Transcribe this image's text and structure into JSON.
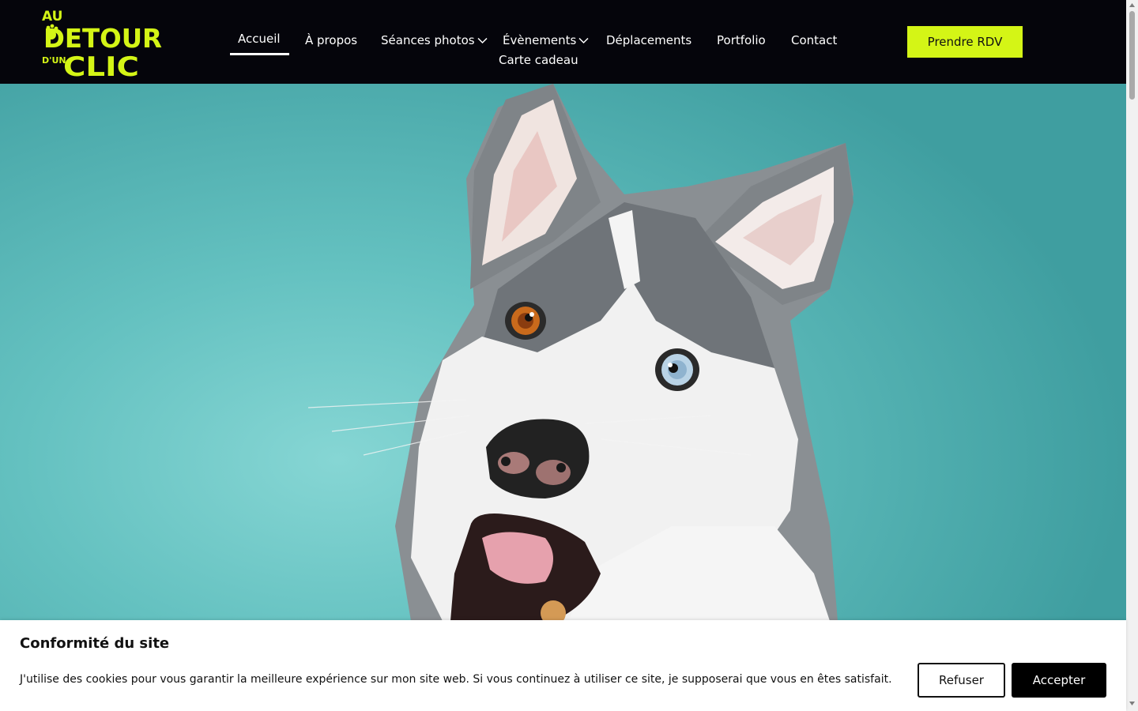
{
  "brand": {
    "logo_line1": "AU",
    "logo_line2": "DETOUR",
    "logo_line3a": "D'UN",
    "logo_line3b": "CLIC",
    "accent_color": "#d4f516"
  },
  "nav": {
    "items": [
      {
        "label": "Accueil",
        "active": true
      },
      {
        "label": "À propos"
      },
      {
        "label": "Séances photos",
        "has_submenu": true
      },
      {
        "label": "Évènements",
        "has_submenu": true
      },
      {
        "label": "Déplacements"
      },
      {
        "label": "Portfolio"
      },
      {
        "label": "Contact"
      },
      {
        "label": "Carte cadeau"
      }
    ],
    "cta": "Prendre RDV"
  },
  "hero": {
    "icon": "husky-dog-photo"
  },
  "cookie": {
    "title": "Conformité du site",
    "text": "J'utilise des cookies pour vous garantir la meilleure expérience sur mon site web. Si vous continuez à utiliser ce site, je supposerai que vous en êtes satisfait.",
    "refuse": "Refuser",
    "accept": "Accepter"
  }
}
